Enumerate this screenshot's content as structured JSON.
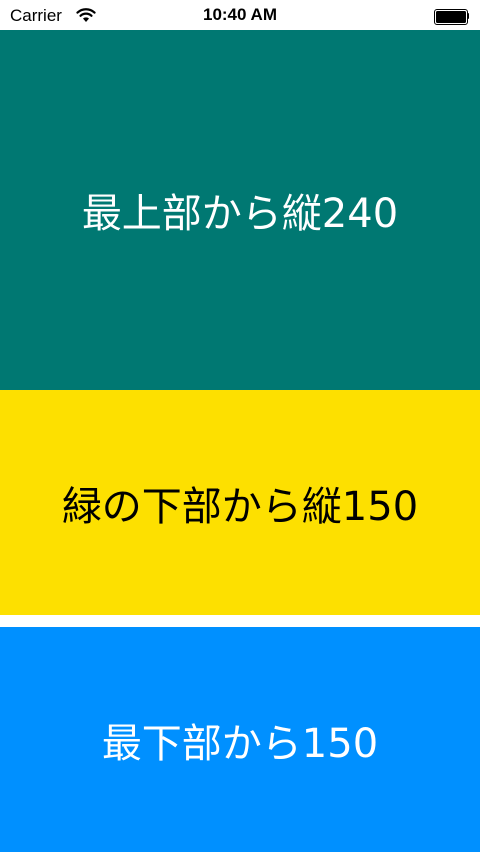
{
  "status_bar": {
    "carrier": "Carrier",
    "time": "10:40 AM",
    "wifi_icon": "wifi-icon",
    "battery_icon": "battery-icon",
    "battery_level": 1.0
  },
  "blocks": [
    {
      "label": "最上部から縦240",
      "color": "#007872",
      "text_color": "#ffffff"
    },
    {
      "label": "緑の下部から縦150",
      "color": "#fde000",
      "text_color": "#000000"
    },
    {
      "label": "最下部から150",
      "color": "#0090ff",
      "text_color": "#ffffff"
    }
  ]
}
